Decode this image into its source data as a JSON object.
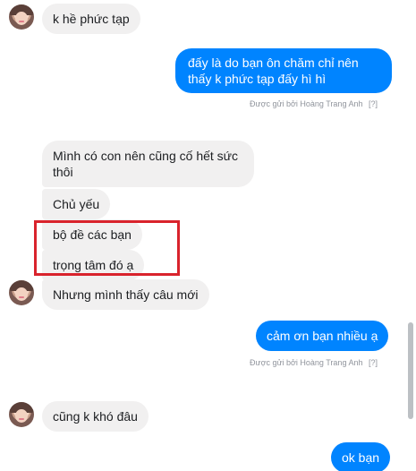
{
  "messages": {
    "m1": "k hề phức tạp",
    "m2_line1": "đấy là do bạn ôn chăm chỉ nên",
    "m2_line2": "thấy k phức tạp đấy hì hì",
    "sent_by_1": "Được gửi bởi Hoàng Trang Anh",
    "help_1": "[?]",
    "m3_line1": "Mình có con nên cũng cố hết sức",
    "m3_line2": "thôi",
    "m4": "Chủ yếu",
    "m5": "bộ đề các bạn",
    "m6": "trọng tâm đó ạ",
    "m7": "Nhưng mình thấy câu mới",
    "m8": "cảm ơn bạn nhiều ạ",
    "sent_by_2": "Được gửi bởi Hoàng Trang Anh",
    "help_2": "[?]",
    "m9": "cũng k khó đâu",
    "m10": "ok bạn"
  },
  "colors": {
    "incoming_bubble": "#f1f0f0",
    "outgoing_bubble": "#0084ff",
    "highlight_box": "#d9232c"
  }
}
